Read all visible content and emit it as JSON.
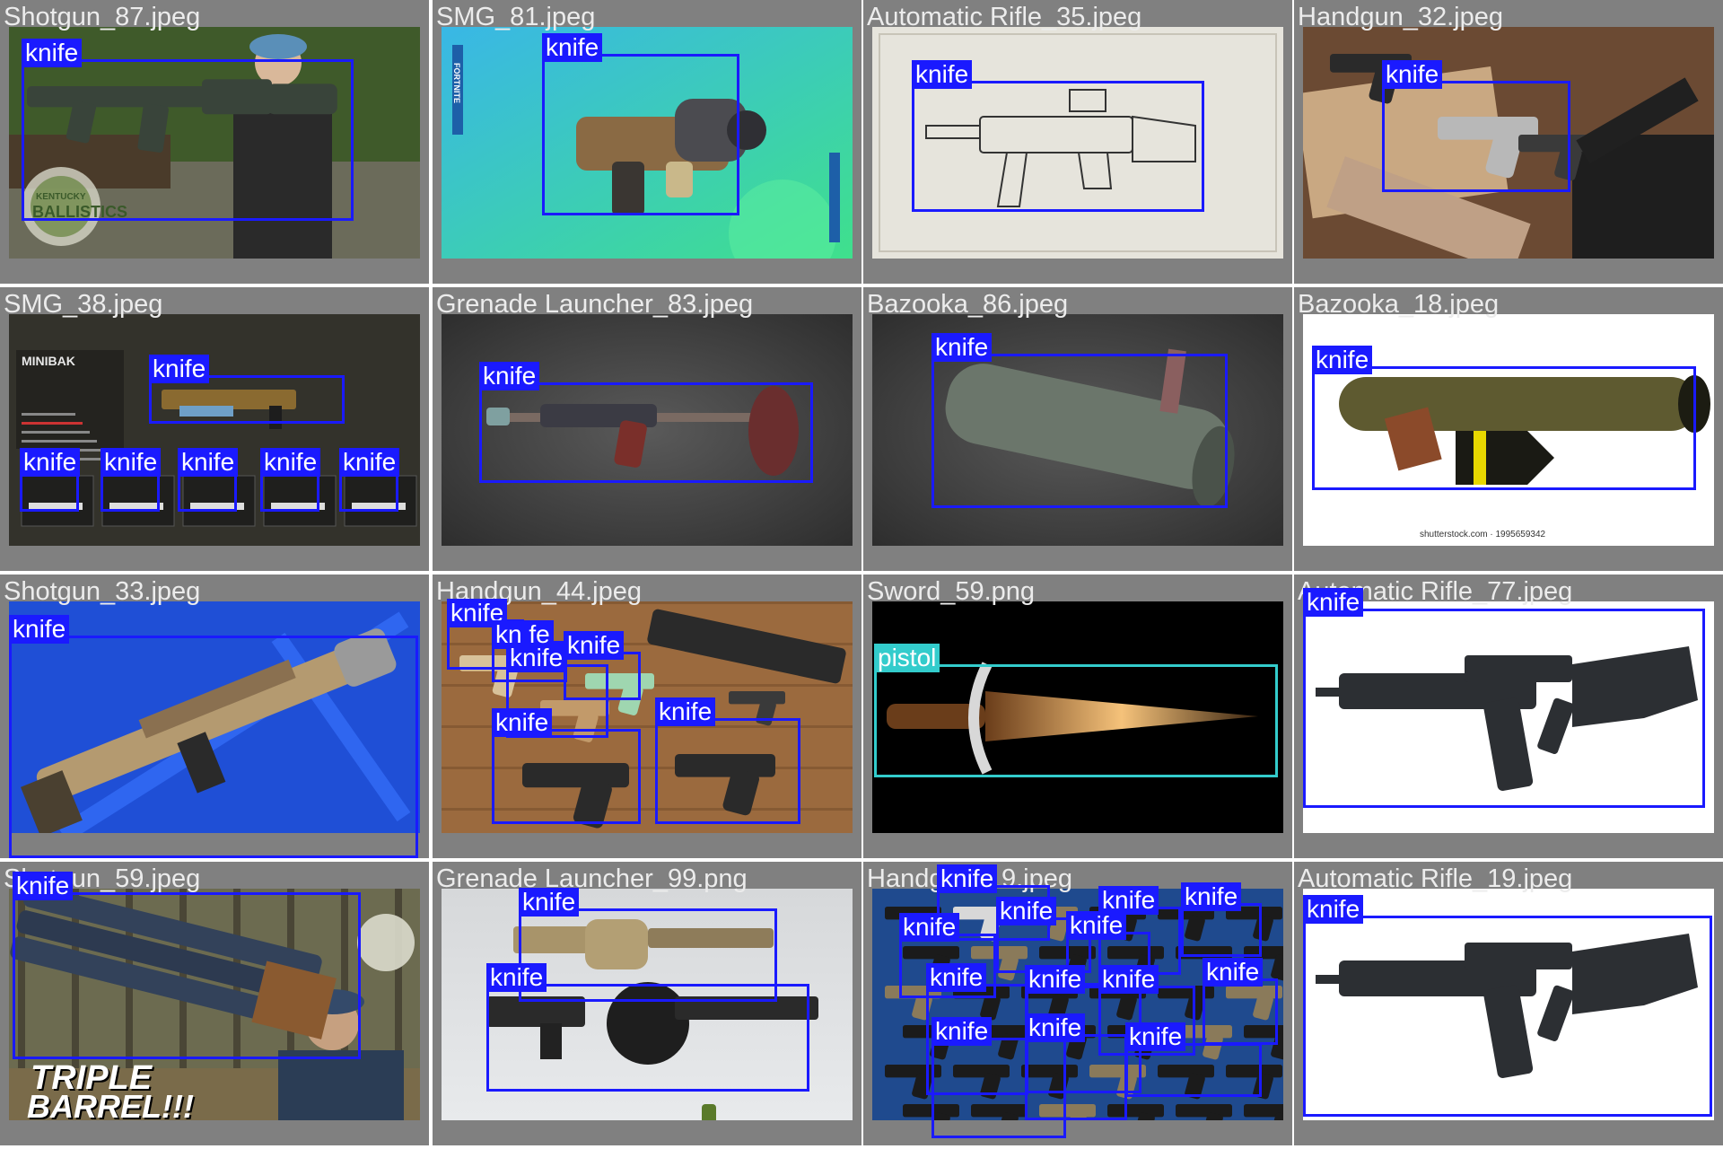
{
  "cells": [
    {
      "filename": "Shotgun_87.jpeg",
      "scene": "outdoor",
      "overlay_text": [
        "KENTUCKY",
        "BALLISTICS"
      ],
      "boxes": [
        {
          "label": "knife"
        }
      ]
    },
    {
      "filename": "SMG_81.jpeg",
      "scene": "fortnite",
      "overlay_text": [
        "FORTNITE"
      ],
      "boxes": [
        {
          "label": "knife"
        }
      ]
    },
    {
      "filename": "Automatic Rifle_35.jpeg",
      "scene": "sketch",
      "boxes": [
        {
          "label": "knife"
        }
      ]
    },
    {
      "filename": "Handgun_32.jpeg",
      "scene": "table",
      "boxes": [
        {
          "label": "knife"
        }
      ]
    },
    {
      "filename": "SMG_38.jpeg",
      "scene": "game-ui",
      "overlay_text": [
        "MINIBAK"
      ],
      "boxes": [
        {
          "label": "knife"
        },
        {
          "label": "knife"
        },
        {
          "label": "knife"
        },
        {
          "label": "knife"
        },
        {
          "label": "knife"
        },
        {
          "label": "knife"
        }
      ]
    },
    {
      "filename": "Grenade Launcher_83.jpeg",
      "scene": "dark-studio",
      "boxes": [
        {
          "label": "knife"
        }
      ]
    },
    {
      "filename": "Bazooka_86.jpeg",
      "scene": "dark-studio",
      "boxes": [
        {
          "label": "knife"
        }
      ]
    },
    {
      "filename": "Bazooka_18.jpeg",
      "scene": "white",
      "overlay_text": [
        "shutterstock.com · 1995659342"
      ],
      "boxes": [
        {
          "label": "knife"
        }
      ]
    },
    {
      "filename": "Shotgun_33.jpeg",
      "scene": "blue",
      "boxes": [
        {
          "label": "knife"
        }
      ]
    },
    {
      "filename": "Handgun_44.jpeg",
      "scene": "wood",
      "boxes": [
        {
          "label": "knife"
        },
        {
          "label": "kn fe"
        },
        {
          "label": "knife"
        },
        {
          "label": "knife"
        },
        {
          "label": "knife"
        },
        {
          "label": "knife"
        }
      ]
    },
    {
      "filename": "Sword_59.png",
      "scene": "black",
      "boxes": [
        {
          "label": "pistol",
          "color": "#33cccc"
        }
      ]
    },
    {
      "filename": "Automatic Rifle_77.jpeg",
      "scene": "white",
      "boxes": [
        {
          "label": "knife"
        }
      ]
    },
    {
      "filename": "Shotgun_59.jpeg",
      "scene": "forest",
      "overlay_text": [
        "TRIPLE",
        "BARREL!!!"
      ],
      "boxes": [
        {
          "label": "knife"
        }
      ]
    },
    {
      "filename": "Grenade Launcher_99.png",
      "scene": "light-grey",
      "boxes": [
        {
          "label": "knife"
        },
        {
          "label": "knife"
        }
      ]
    },
    {
      "filename": "Handgun_19.jpeg",
      "scene": "blue-foam",
      "boxes": [
        {
          "label": "knife"
        },
        {
          "label": "knife"
        },
        {
          "label": "knife"
        },
        {
          "label": "knife"
        },
        {
          "label": "knife"
        },
        {
          "label": "knife"
        },
        {
          "label": "knife"
        },
        {
          "label": "knife"
        },
        {
          "label": "knife"
        },
        {
          "label": "knife"
        },
        {
          "label": "knife"
        },
        {
          "label": "knife"
        },
        {
          "label": "knife"
        }
      ]
    },
    {
      "filename": "Automatic Rifle_19.jpeg",
      "scene": "white",
      "boxes": [
        {
          "label": "knife"
        }
      ]
    }
  ]
}
